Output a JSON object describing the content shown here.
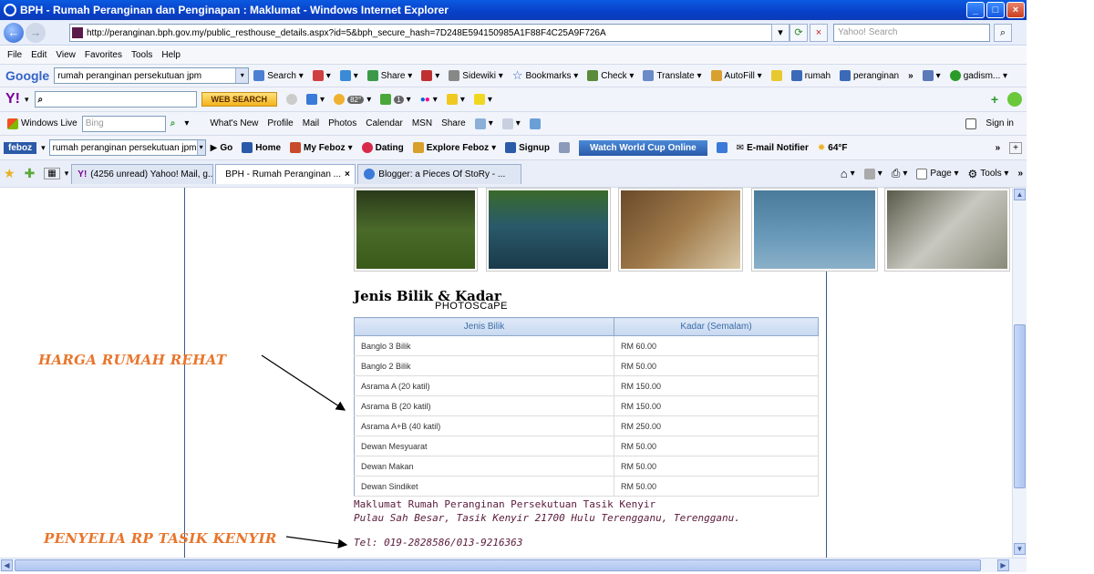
{
  "window": {
    "title": "BPH - Rumah Peranginan dan Penginapan : Maklumat - Windows Internet Explorer",
    "min": "_",
    "max": "□",
    "close": "×"
  },
  "address": {
    "url": "http://peranginan.bph.gov.my/public_resthouse_details.aspx?id=5&bph_secure_hash=7D248E594150985A1F88F4C25A9F726A",
    "search_placeholder": "Yahoo! Search"
  },
  "menu": [
    "File",
    "Edit",
    "View",
    "Favorites",
    "Tools",
    "Help"
  ],
  "google": {
    "logo": "Google",
    "query": "rumah peranginan persekutuan jpm",
    "items": [
      "Search ▾",
      "Share ▾",
      "Sidewiki ▾",
      "Bookmarks ▾",
      "Check ▾",
      "Translate ▾",
      "AutoFill ▾",
      "rumah",
      "peranginan",
      "»",
      "gadism... ▾"
    ]
  },
  "yahoo": {
    "logo": "Y!",
    "search_button": "WEB SEARCH",
    "badge_weather": "82°",
    "badge_count": "1"
  },
  "windows_live": {
    "label": "Windows Live",
    "search_placeholder": "Bing",
    "items": [
      "What's New",
      "Profile",
      "Mail",
      "Photos",
      "Calendar",
      "MSN",
      "Share"
    ],
    "signin": "Sign in"
  },
  "feboz": {
    "logo": "feboz",
    "query": "rumah peranginan persekutuan jpm",
    "items": [
      "Go",
      "Home",
      "My Feboz",
      "Dating",
      "Explore Feboz",
      "Signup"
    ],
    "watch": "Watch World Cup Online",
    "email": "E-mail Notifier",
    "temp": "64°F"
  },
  "tabs": [
    {
      "label": "(4256 unread) Yahoo! Mail, g..."
    },
    {
      "label": "BPH - Rumah Peranginan ..."
    },
    {
      "label": "Blogger: a Pieces Of StoRy - ..."
    }
  ],
  "command": {
    "page": "Page ▾",
    "tools": "Tools ▾"
  },
  "content": {
    "heading": "Jenis Bilik & Kadar",
    "photoscape": "PHOTOSCaPE",
    "table_headers": [
      "Jenis Bilik",
      "Kadar (Semalam)"
    ],
    "rows": [
      [
        "Banglo 3 Bilik",
        "RM 60.00"
      ],
      [
        "Banglo 2 Bilik",
        "RM 50.00"
      ],
      [
        "Asrama A (20 katil)",
        "RM 150.00"
      ],
      [
        "Asrama B (20 katil)",
        "RM 150.00"
      ],
      [
        "Asrama A+B (40 katil)",
        "RM 250.00"
      ],
      [
        "Dewan Mesyuarat",
        "RM 50.00"
      ],
      [
        "Dewan Makan",
        "RM 50.00"
      ],
      [
        "Dewan Sindiket",
        "RM 50.00"
      ]
    ],
    "info_line1": "Maklumat Rumah Peranginan Persekutuan Tasik Kenyir",
    "info_line2": "Pulau Sah Besar, Tasik Kenyir 21700 Hulu Terengganu, Terengganu.",
    "tel": "Tel: 019-2828586/013-9216363"
  },
  "annotations": {
    "harga": "HARGA RUMAH REHAT",
    "penyelia": "PENYELIA RP TASIK KENYIR"
  },
  "colors": {
    "titlebar": "#0840c8",
    "annotation": "#e8762c",
    "table_header_text": "#3a6ea8"
  }
}
